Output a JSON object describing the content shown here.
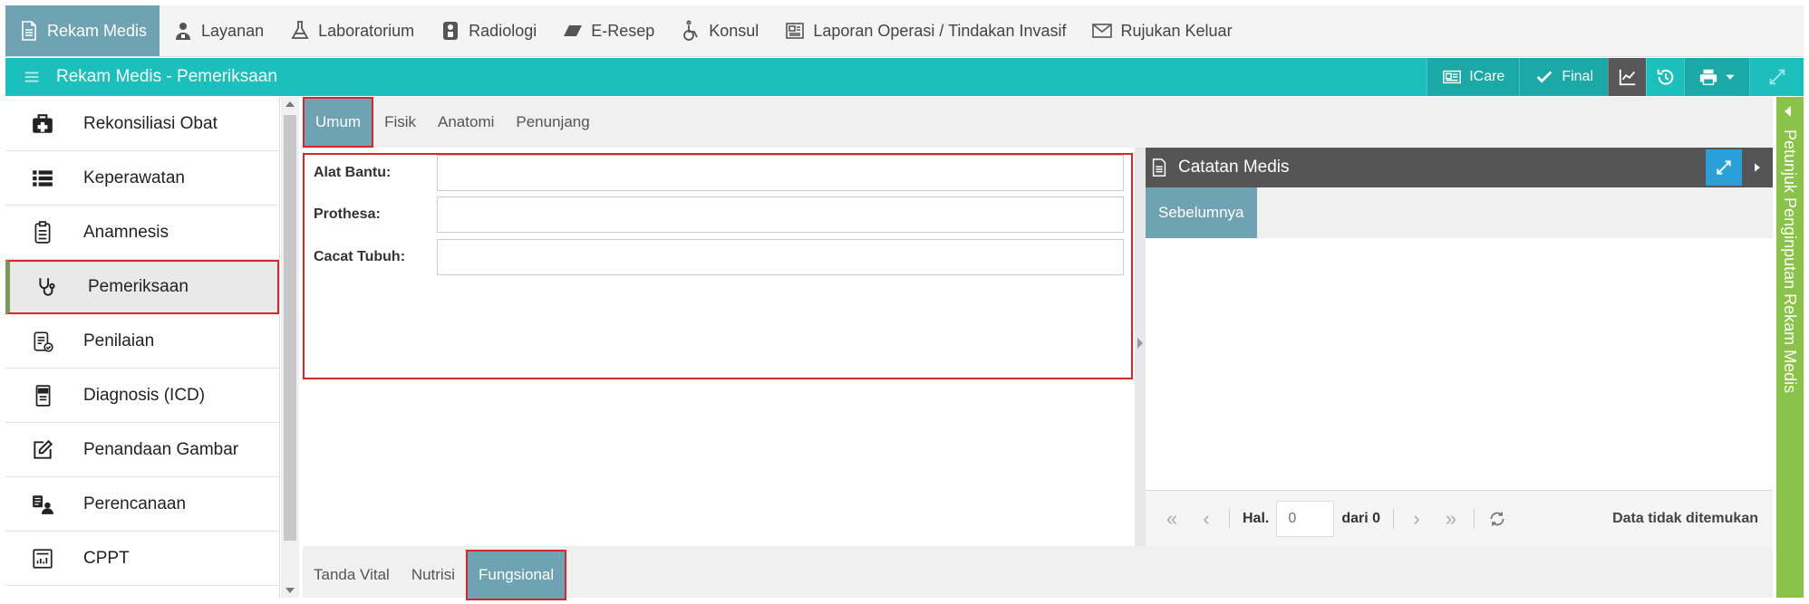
{
  "topnav": {
    "items": [
      {
        "label": "Rekam Medis",
        "icon": "document-icon"
      },
      {
        "label": "Layanan",
        "icon": "user-nurse-icon"
      },
      {
        "label": "Laboratorium",
        "icon": "flask-icon"
      },
      {
        "label": "Radiologi",
        "icon": "xray-icon"
      },
      {
        "label": "E-Resep",
        "icon": "eraser-icon"
      },
      {
        "label": "Konsul",
        "icon": "wheelchair-icon"
      },
      {
        "label": "Laporan Operasi / Tindakan Invasif",
        "icon": "newspaper-icon"
      },
      {
        "label": "Rujukan Keluar",
        "icon": "envelope-icon"
      }
    ]
  },
  "titlebar": {
    "title": "Rekam Medis - Pemeriksaan",
    "icare_label": "ICare",
    "final_label": "Final"
  },
  "sidebar": {
    "items": [
      {
        "label": "Rekonsiliasi Obat",
        "icon": "medkit-icon"
      },
      {
        "label": "Keperawatan",
        "icon": "list-icon"
      },
      {
        "label": "Anamnesis",
        "icon": "clipboard-icon"
      },
      {
        "label": "Pemeriksaan",
        "icon": "stethoscope-icon"
      },
      {
        "label": "Penilaian",
        "icon": "clipboard-check-icon"
      },
      {
        "label": "Diagnosis (ICD)",
        "icon": "icd-book-icon"
      },
      {
        "label": "Penandaan Gambar",
        "icon": "edit-icon"
      },
      {
        "label": "Perencanaan",
        "icon": "planning-icon"
      },
      {
        "label": "CPPT",
        "icon": "chart-report-icon"
      }
    ]
  },
  "tabs_top": [
    "Umum",
    "Fisik",
    "Anatomi",
    "Penunjang"
  ],
  "form": {
    "alat_bantu_label": "Alat Bantu:",
    "alat_bantu_value": "",
    "prothesa_label": "Prothesa:",
    "prothesa_value": "",
    "cacat_tubuh_label": "Cacat Tubuh:",
    "cacat_tubuh_value": ""
  },
  "notes": {
    "title": "Catatan Medis",
    "tab": "Sebelumnya",
    "pager": {
      "hal_label": "Hal.",
      "page_placeholder": "0",
      "of_label": "dari 0",
      "status": "Data tidak ditemukan"
    }
  },
  "tabs_bottom": [
    "Tanda Vital",
    "Nutrisi",
    "Fungsional"
  ],
  "help_rail": {
    "label": "Petunjuk Penginputan Rekam Medis"
  },
  "colors": {
    "accent": "#1bbfbc",
    "active_tab": "#6fa3b3",
    "highlight": "#d9262b",
    "help": "#8bc34a"
  }
}
